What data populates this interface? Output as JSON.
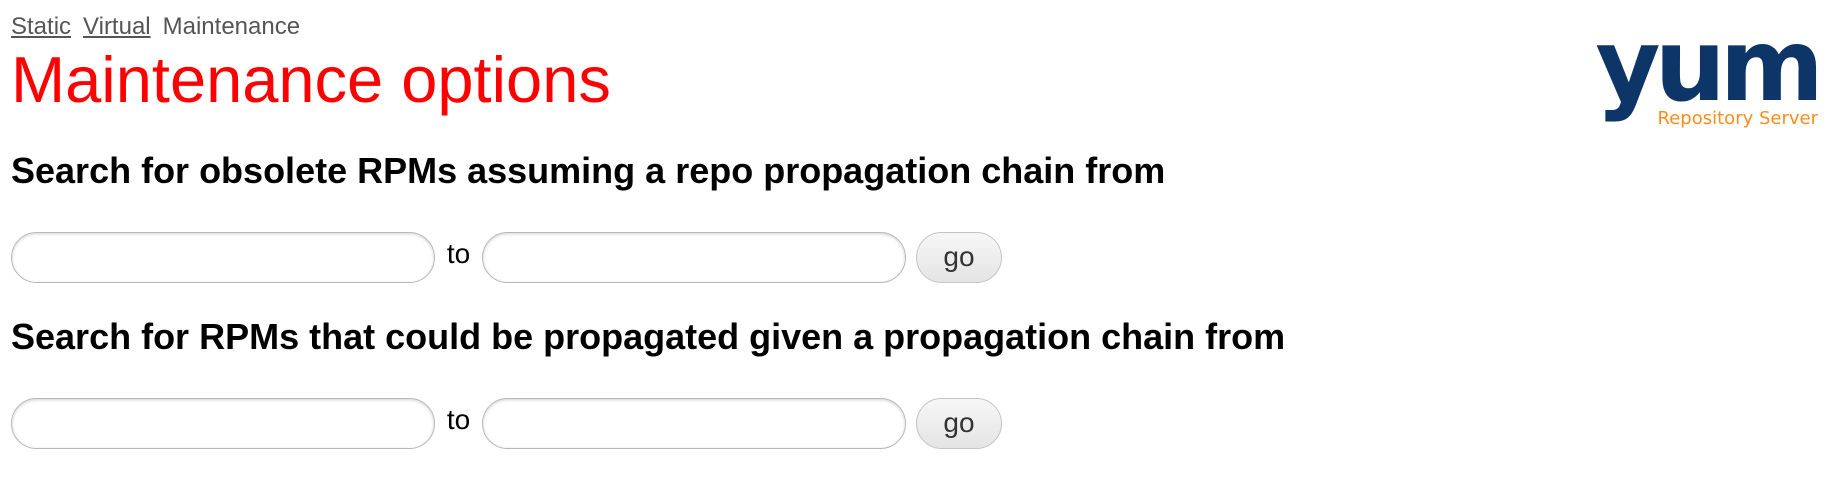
{
  "nav": {
    "links": [
      "Static",
      "Virtual"
    ],
    "current": "Maintenance"
  },
  "page_title": "Maintenance options",
  "logo": {
    "wordmark": "yum",
    "tagline": "Repository Server",
    "colors": {
      "wordmark": "#0e3568",
      "tagline": "#ff8c1a"
    }
  },
  "sections": [
    {
      "heading": "Search for obsolete RPMs assuming a repo propagation chain from",
      "from_value": "",
      "to_label": "to",
      "to_value": "",
      "button_label": "go"
    },
    {
      "heading": "Search for RPMs that could be propagated given a propagation chain from",
      "from_value": "",
      "to_label": "to",
      "to_value": "",
      "button_label": "go"
    }
  ],
  "colors": {
    "title": "#ff0000",
    "nav_text": "#555555"
  }
}
